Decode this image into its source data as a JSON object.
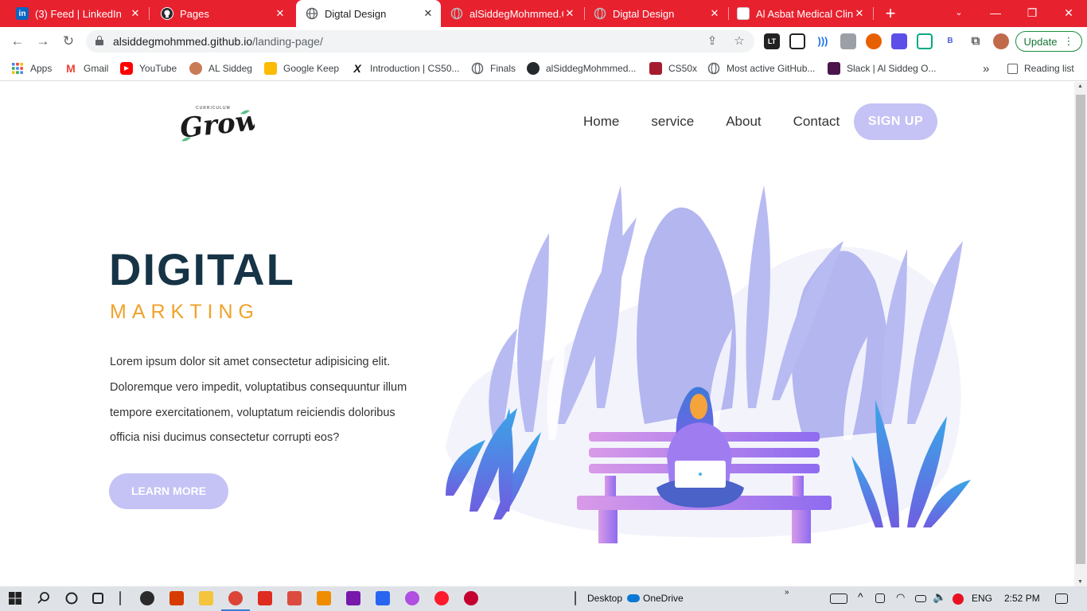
{
  "browser": {
    "tabs": [
      {
        "title": "(3) Feed | LinkedIn",
        "icon": "linkedin-icon",
        "color": "#0a66c2",
        "active": false
      },
      {
        "title": "Pages",
        "icon": "github-icon",
        "color": "#24292e",
        "active": false
      },
      {
        "title": "Digtal Design",
        "icon": "globe-icon",
        "color": "#5f6368",
        "active": true
      },
      {
        "title": "alSiddegMohmmed.GitHub.io",
        "icon": "globe-icon",
        "color": "#9a9a9a",
        "active": false
      },
      {
        "title": "Digtal Design",
        "icon": "globe-icon",
        "color": "#9a9a9a",
        "active": false
      },
      {
        "title": "Al Asbat Medical Clinic",
        "icon": "clinic-icon",
        "color": "#ffffff",
        "active": false
      }
    ],
    "url_host": "alsiddegmohmmed.github.io",
    "url_path": "/landing-page/",
    "update_label": "Update",
    "bookmarks": [
      {
        "label": "Apps",
        "icon": "apps-grid-icon"
      },
      {
        "label": "Gmail",
        "icon": "gmail-icon"
      },
      {
        "label": "YouTube",
        "icon": "youtube-icon"
      },
      {
        "label": "AL Siddeg",
        "icon": "avatar-icon"
      },
      {
        "label": "Google Keep",
        "icon": "keep-icon"
      },
      {
        "label": "Introduction | CS50...",
        "icon": "edx-icon"
      },
      {
        "label": "Finals",
        "icon": "globe-icon"
      },
      {
        "label": "alSiddegMohmmed...",
        "icon": "github-icon"
      },
      {
        "label": "CS50x",
        "icon": "harvard-icon"
      },
      {
        "label": "Most active GitHub...",
        "icon": "globe-icon"
      },
      {
        "label": "Slack | Al Siddeg O...",
        "icon": "slack-icon"
      }
    ],
    "more_bookmarks": "»",
    "reading_list": "Reading list"
  },
  "site": {
    "nav": [
      "Home",
      "service",
      "About",
      "Contact"
    ],
    "signup_label": "SIGN UP",
    "hero_title": "DIGITAL",
    "hero_subtitle": "MARKTING",
    "hero_text": "Lorem ipsum dolor sit amet consectetur adipisicing elit. Doloremque vero impedit, voluptatibus consequuntur illum tempore exercitationem, voluptatum reiciendis doloribus officia nisi ducimus consectetur corrupti eos?",
    "learn_more_label": "LEARN MORE",
    "logo_text": "Grow",
    "logo_tagline": "CURRICULUM"
  },
  "taskbar": {
    "desktop_label": "Desktop",
    "onedrive_label": "OneDrive",
    "language": "ENG",
    "time": "2:52 PM"
  },
  "colors": {
    "tab_strip": "#e8212f",
    "accent_button": "#c5c2f5",
    "hero_title": "#163446",
    "hero_subtitle": "#f0a22b"
  }
}
